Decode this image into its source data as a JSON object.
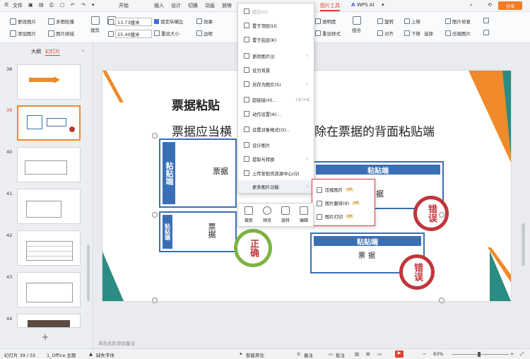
{
  "menubar": {
    "file": "文件",
    "tabs": [
      "开始",
      "插入",
      "设计",
      "切换",
      "动画",
      "放映"
    ],
    "active_tab": "图片工具",
    "wps_ai": "WPS AI",
    "share": "分享"
  },
  "ribbon": {
    "change_picture": "更改图片",
    "multi_outline": "多图轮播",
    "add_picture": "添加图片",
    "picture_splice": "图片拼接",
    "crop": "裁剪",
    "width": "13.73厘米",
    "height": "25.40厘米",
    "lock_ratio": "锁定纵横比",
    "reset_size": "重设大小",
    "effect": "效果",
    "border": "边框",
    "transparency": "透明度",
    "reset_style": "重设样式",
    "combine": "组合",
    "align": "对齐",
    "rotate": "旋转",
    "up": "上移",
    "down": "下移",
    "select": "选择",
    "picture_repair": "图片修复",
    "compress": "压缩图片"
  },
  "sidebar": {
    "tab_outline": "大纲",
    "tab_slides": "幻灯片",
    "add_symbol": "+",
    "slides": [
      "38",
      "39",
      "40",
      "41",
      "42",
      "43",
      "44"
    ]
  },
  "slide": {
    "title": "票据粘贴",
    "subtitle_left": "票据应当横",
    "subtitle_right": "除在票据的背面粘贴端",
    "paste_end": "粘贴端",
    "paste_end_v1": "粘贴端",
    "bill": "票据",
    "bill_v": "票据",
    "wrong": "错误",
    "correct": "正确",
    "label_ju": "据"
  },
  "context_menu": {
    "items": [
      {
        "label": "组合(G)",
        "disabled": true
      },
      {
        "label": "置于顶层(U)"
      },
      {
        "label": "置于底层(K)"
      },
      {
        "label": "更改图片(J)",
        "arrow": true
      },
      {
        "label": "设为背景"
      },
      {
        "label": "另存为图片(S)",
        "arrow": true
      },
      {
        "label": "超链接(H)...",
        "shortcut": "Ctrl+K"
      },
      {
        "label": "动作设置(A)..."
      },
      {
        "label": "设置对象格式(O)..."
      },
      {
        "label": "设计图片"
      },
      {
        "label": "提取与转换",
        "arrow": true
      },
      {
        "label": "上传至稻壳资源中心(Q)"
      },
      {
        "label": "更多图片功能",
        "arrow": true
      }
    ]
  },
  "submenu": {
    "items": [
      "压缩图片",
      "图片翻译(9)",
      "图片打印"
    ],
    "vip": "VIP"
  },
  "quickbar": {
    "items": [
      "裁剪",
      "预览",
      "旋转",
      "编辑"
    ]
  },
  "notes_placeholder": "单击此处添加备注",
  "statusbar": {
    "slide_pos": "幻灯片 39 / 55",
    "theme": "1_Office 主题",
    "missing_font": "缺失字体",
    "beautify": "智能美化",
    "notes": "备注",
    "comment": "批注",
    "zoom": "83%"
  },
  "colors": {
    "accent_orange": "#f08a2a",
    "accent_teal": "#2a8c82",
    "box_blue": "#3a6fb5",
    "wrong_red": "#c0363c",
    "correct_green": "#7cb342"
  }
}
